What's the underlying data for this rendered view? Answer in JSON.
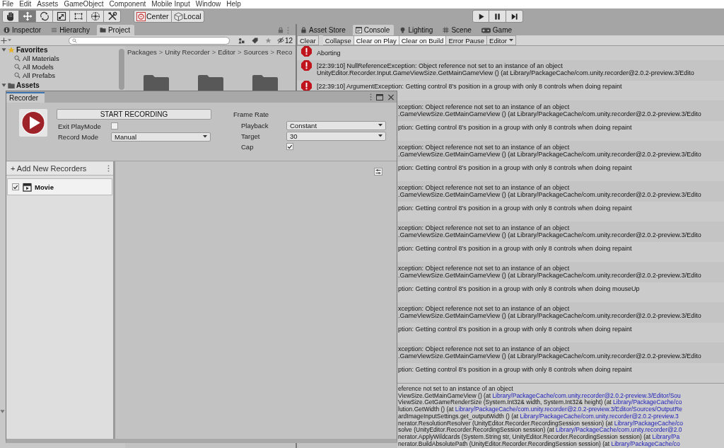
{
  "menu_bar": [
    "File",
    "Edit",
    "Assets",
    "GameObject",
    "Component",
    "Mobile Input",
    "Window",
    "Help"
  ],
  "toolbar": {
    "tools": [
      {
        "kind": "hand",
        "selected": false
      },
      {
        "kind": "move",
        "selected": true
      },
      {
        "kind": "rotate",
        "selected": false
      },
      {
        "kind": "scale",
        "selected": false
      },
      {
        "kind": "rect",
        "selected": false
      },
      {
        "kind": "transform",
        "selected": false
      },
      {
        "kind": "custom",
        "selected": false
      }
    ],
    "handle_buttons": [
      {
        "kind": "pivot",
        "label": "Center"
      },
      {
        "kind": "space",
        "label": "Local"
      }
    ],
    "play_controls": [
      {
        "kind": "play"
      },
      {
        "kind": "pause"
      },
      {
        "kind": "step"
      }
    ]
  },
  "left_panel": {
    "tabs": [
      {
        "kind": "inspector",
        "label": "Inspector",
        "selected": false
      },
      {
        "kind": "hierarchy",
        "label": "Hierarchy",
        "selected": false
      },
      {
        "kind": "project",
        "label": "Project",
        "selected": true
      }
    ],
    "hidden_count": "12",
    "tree": [
      {
        "kind": "favorites",
        "label": "Favorites",
        "expanded": true,
        "children": [
          {
            "label": "All Materials"
          },
          {
            "label": "All Models"
          },
          {
            "label": "All Prefabs"
          }
        ]
      },
      {
        "kind": "folder",
        "label": "Assets",
        "expanded": true
      }
    ],
    "covered_foldout": {
      "expanded": true
    },
    "breadcrumbs": [
      "Packages",
      "Unity Recorder",
      "Editor",
      "Sources",
      "Reco"
    ],
    "breadcrumb_separator": ">",
    "folders": [
      {
        "kind": "folder"
      },
      {
        "kind": "folder"
      },
      {
        "kind": "folder"
      }
    ]
  },
  "right_panel": {
    "tabs": [
      {
        "kind": "asset_store",
        "label": "Asset Store",
        "selected": false
      },
      {
        "kind": "console",
        "label": "Console",
        "selected": true
      },
      {
        "kind": "lighting",
        "label": "Lighting",
        "selected": false
      },
      {
        "kind": "scene",
        "label": "Scene",
        "selected": false
      },
      {
        "kind": "game",
        "label": "Game",
        "selected": false
      }
    ],
    "console_toolbar": [
      {
        "kind": "button",
        "label": "Clear"
      },
      {
        "kind": "toggle",
        "label": "Collapse",
        "on": false
      },
      {
        "kind": "toggle",
        "label": "Clear on Play",
        "on": true
      },
      {
        "kind": "toggle",
        "label": "Clear on Build",
        "on": true
      },
      {
        "kind": "toggle",
        "label": "Error Pause",
        "on": false
      },
      {
        "kind": "dropdown",
        "label": "Editor"
      }
    ],
    "log": [
      {
        "kind": "error",
        "lines": [
          "Aborting"
        ]
      },
      {
        "kind": "error",
        "lines": [
          "[22:39:10] NullReferenceException: Object reference not set to an instance of an object",
          "UnityEditor.Recorder.Input.GameViewSize.GetMainGameView () (at Library/PackageCache/com.unity.recorder@2.0.2-preview.3/Edito"
        ]
      },
      {
        "kind": "error",
        "lines": [
          "[22:39:10] ArgumentException: Getting control 8's position in a group with only 8 controls when doing repaint"
        ]
      },
      {
        "kind": "covered",
        "lines": [
          "xception: Object reference not set to an instance of an object",
          ".GameViewSize.GetMainGameView () (at Library/PackageCache/com.unity.recorder@2.0.2-preview.3/Edito"
        ]
      },
      {
        "kind": "covered",
        "lines": [
          "ption: Getting control 8's position in a group with only 8 controls when doing repaint"
        ]
      },
      {
        "kind": "covered",
        "lines": [
          "xception: Object reference not set to an instance of an object",
          ".GameViewSize.GetMainGameView () (at Library/PackageCache/com.unity.recorder@2.0.2-preview.3/Edito"
        ]
      },
      {
        "kind": "covered",
        "lines": [
          "ption: Getting control 8's position in a group with only 8 controls when doing repaint"
        ]
      },
      {
        "kind": "covered",
        "lines": [
          "xception: Object reference not set to an instance of an object",
          ".GameViewSize.GetMainGameView () (at Library/PackageCache/com.unity.recorder@2.0.2-preview.3/Edito"
        ]
      },
      {
        "kind": "covered",
        "lines": [
          "ption: Getting control 8's position in a group with only 8 controls when doing repaint"
        ]
      },
      {
        "kind": "covered",
        "lines": [
          "xception: Object reference not set to an instance of an object",
          ".GameViewSize.GetMainGameView () (at Library/PackageCache/com.unity.recorder@2.0.2-preview.3/Edito"
        ]
      },
      {
        "kind": "covered",
        "lines": [
          "ption: Getting control 8's position in a group with only 8 controls when doing repaint"
        ]
      },
      {
        "kind": "covered",
        "lines": [
          "xception: Object reference not set to an instance of an object",
          ".GameViewSize.GetMainGameView () (at Library/PackageCache/com.unity.recorder@2.0.2-preview.3/Edito"
        ]
      },
      {
        "kind": "covered",
        "lines": [
          "ption: Getting control 8's position in a group with only 8 controls when doing mouseUp"
        ]
      },
      {
        "kind": "covered",
        "lines": [
          "xception: Object reference not set to an instance of an object",
          ".GameViewSize.GetMainGameView () (at Library/PackageCache/com.unity.recorder@2.0.2-preview.3/Edito"
        ]
      },
      {
        "kind": "covered",
        "lines": [
          "ption: Getting control 8's position in a group with only 8 controls when doing repaint"
        ]
      },
      {
        "kind": "covered",
        "lines": [
          "xception: Object reference not set to an instance of an object",
          ".GameViewSize.GetMainGameView () (at Library/PackageCache/com.unity.recorder@2.0.2-preview.3/Edito"
        ]
      },
      {
        "kind": "covered",
        "lines": [
          "ption: Getting control 8's position in a group with only 8 controls when doing repaint"
        ]
      }
    ],
    "stack_trace": [
      {
        "text": "eference not set to an instance of an object"
      },
      {
        "text": "ViewSize.GetMainGameView () (at ",
        "link": "Library/PackageCache/com.unity.recorder@2.0.2-preview.3/Editor/Sou"
      },
      {
        "text": "ViewSize.GetGameRenderSize (System.Int32& width, System.Int32& height) (at ",
        "link": "Library/PackageCache/co"
      },
      {
        "text": "lution.GetWidth () (at ",
        "link": "Library/PackageCache/com.unity.recorder@2.0.2-preview.3/Editor/Sources/OutputRe"
      },
      {
        "text": "ardImageInputSettings.get_outputWidth () (at ",
        "link": "Library/PackageCache/com.unity.recorder@2.0.2-preview.3"
      },
      {
        "text": "nerator.ResolutionResolver (UnityEditor.Recorder.RecordingSession session) (at ",
        "link": "Library/PackageCache/co"
      },
      {
        "text": "solve (UnityEditor.Recorder.RecordingSession session) (at ",
        "link": "Library/PackageCache/com.unity.recorder@2.0"
      },
      {
        "text": "nerator.ApplyWildcards (System.String str, UnityEditor.Recorder.RecordingSession session) (at ",
        "link": "Library/Pa"
      },
      {
        "text": "nerator.BuildAbsolutePath (UnityEditor.Recorder.RecordingSession session) (at ",
        "link": "Library/PackageCache/co"
      }
    ]
  },
  "recorder_window": {
    "title": "Recorder",
    "start_button": "START RECORDING",
    "exit_playmode": {
      "label": "Exit PlayMode",
      "checked": false
    },
    "record_mode": {
      "label": "Record Mode",
      "value": "Manual"
    },
    "frame_rate": {
      "label": "Frame Rate",
      "playback": {
        "label": "Playback",
        "value": "Constant"
      },
      "target": {
        "label": "Target",
        "value": "30"
      },
      "cap": {
        "label": "Cap",
        "checked": true
      }
    },
    "add_recorders": "+ Add New Recorders",
    "recorders": [
      {
        "name": "Movie",
        "enabled": true
      }
    ]
  }
}
